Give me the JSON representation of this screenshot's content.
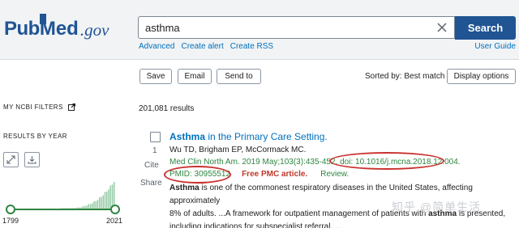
{
  "header": {
    "logo": {
      "pub": "Pub",
      "med": "Med",
      "gov": ".gov"
    },
    "search": {
      "value": "asthma",
      "button_label": "Search"
    },
    "links": [
      "Advanced",
      "Create alert",
      "Create RSS"
    ],
    "user_guide": "User Guide"
  },
  "toolbar": {
    "save_label": "Save",
    "email_label": "Email",
    "send_to_label": "Send to",
    "sorted_by": "Sorted by: Best match",
    "display_options_label": "Display options"
  },
  "sidebar": {
    "ncbi_filters": "MY NCBI FILTERS",
    "results_by_year": "RESULTS BY YEAR",
    "year_start": "1799",
    "year_end": "2021"
  },
  "results": {
    "count": "201,081 results",
    "items": [
      {
        "number": "1",
        "title_highlight": "Asthma",
        "title_rest": " in the Primary Care Setting.",
        "authors": "Wu TD, Brigham EP, McCormack MC.",
        "journal": "Med Clin North Am. 2019 May;103(3):435-452.",
        "doi": "doi: 10.1016/j.mcna.2018.12.004.",
        "pmid": "PMID: 30955512",
        "pmc": "Free PMC article.",
        "type": "Review.",
        "snippet_1_bold": "Asthma",
        "snippet_1_rest": " is one of the commonest respiratory diseases in the United States, affecting approximately",
        "snippet_2_a": "8% of adults. ...A framework for outpatient management of patients with ",
        "snippet_2_bold": "asthma",
        "snippet_2_b": " is presented,",
        "snippet_3": "including indications for subspecialist referral. ..."
      }
    ],
    "cite_label": "Cite",
    "share_label": "Share"
  },
  "watermark": "知乎 @简单生活",
  "colors": {
    "brand": "#205493",
    "link": "#0071bc",
    "green": "#2e8540",
    "highlight_circle": "#c9302c"
  }
}
